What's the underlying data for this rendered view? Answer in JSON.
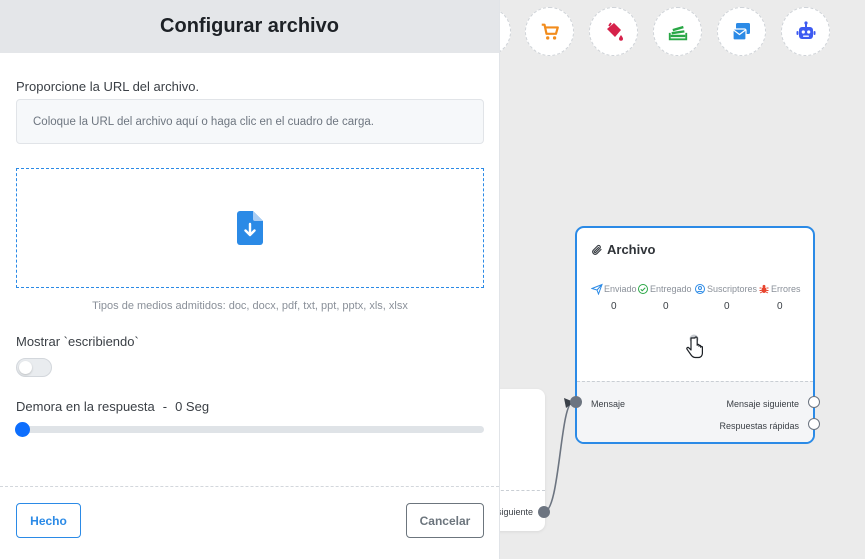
{
  "panel": {
    "title": "Configurar archivo",
    "url_label": "Proporcione la URL del archivo.",
    "url_placeholder": "Coloque la URL del archivo aquí o haga clic en el cuadro de carga.",
    "url_value": "",
    "media_note": "Tipos de medios admitidos: doc, docx, pdf, txt, ppt, pptx, xls, xlsx",
    "typing_label": "Mostrar `escribiendo`",
    "typing_enabled": false,
    "delay_label": "Demora en la respuesta",
    "delay_value": "0 Seg",
    "delay_separator": "-",
    "delay_level": 0,
    "done_button": "Hecho",
    "cancel_button": "Cancelar"
  },
  "toolbar": {
    "icons": [
      "cart-icon",
      "paint-bucket-icon",
      "stack-icon",
      "message-card-icon",
      "robot-icon"
    ]
  },
  "node": {
    "title": "Archivo",
    "stats": [
      {
        "label": "Enviado",
        "value": "0",
        "icon": "paper-plane-icon"
      },
      {
        "label": "Entregado",
        "value": "0",
        "icon": "check-circle-icon"
      },
      {
        "label": "Suscriptores",
        "value": "0",
        "icon": "user-circle-icon"
      },
      {
        "label": "Errores",
        "value": "0",
        "icon": "bug-icon"
      }
    ],
    "input_port_label": "Mensaje",
    "output_next_label": "Mensaje siguiente",
    "output_quick_label": "Respuestas rápidas"
  },
  "back_node": {
    "next_label": "siguiente"
  },
  "colors": {
    "accent": "#2b8ae6",
    "cart": "#f28c1c",
    "bucket": "#d6214a",
    "stack": "#29a745",
    "card": "#2b8ae6",
    "robot": "#3d5af1"
  }
}
